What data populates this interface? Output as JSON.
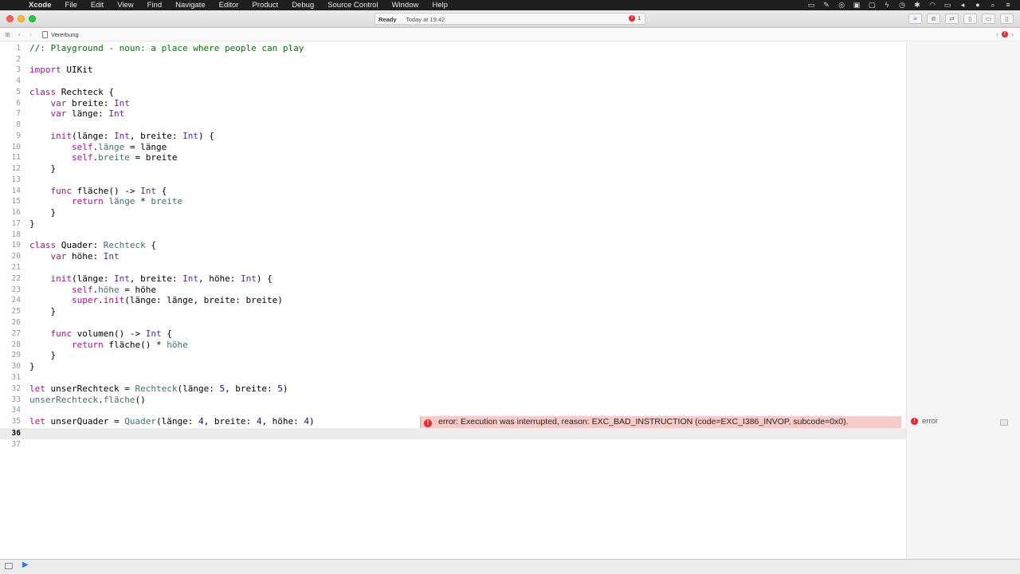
{
  "menubar": {
    "apple_icon": "apple-icon",
    "items": [
      "Xcode",
      "File",
      "Edit",
      "View",
      "Find",
      "Navigate",
      "Editor",
      "Product",
      "Debug",
      "Source Control",
      "Window",
      "Help"
    ]
  },
  "activity": {
    "status": "Ready",
    "time": "Today at 19:42",
    "error_count": "1"
  },
  "jumpbar": {
    "filename": "Vererbung"
  },
  "code": {
    "line_numbers": [
      "1",
      "2",
      "3",
      "4",
      "5",
      "6",
      "7",
      "8",
      "9",
      "10",
      "11",
      "12",
      "13",
      "14",
      "15",
      "16",
      "17",
      "18",
      "19",
      "20",
      "21",
      "22",
      "23",
      "24",
      "25",
      "26",
      "27",
      "28",
      "29",
      "30",
      "31",
      "32",
      "33",
      "34",
      "35",
      "36",
      "37"
    ],
    "current_line": "36"
  },
  "error": {
    "message": "error: Execution was interrupted, reason: EXC_BAD_INSTRUCTION (code=EXC_I386_INVOP, subcode=0x0).",
    "result_label": "error"
  },
  "colors": {
    "error_red": "#e8242a",
    "error_banner": "#f7cbc9",
    "keyword": "#aa0d91",
    "type": "#5c2699",
    "comment": "#007400",
    "number": "#1c00cf",
    "property": "#3f6e74"
  }
}
